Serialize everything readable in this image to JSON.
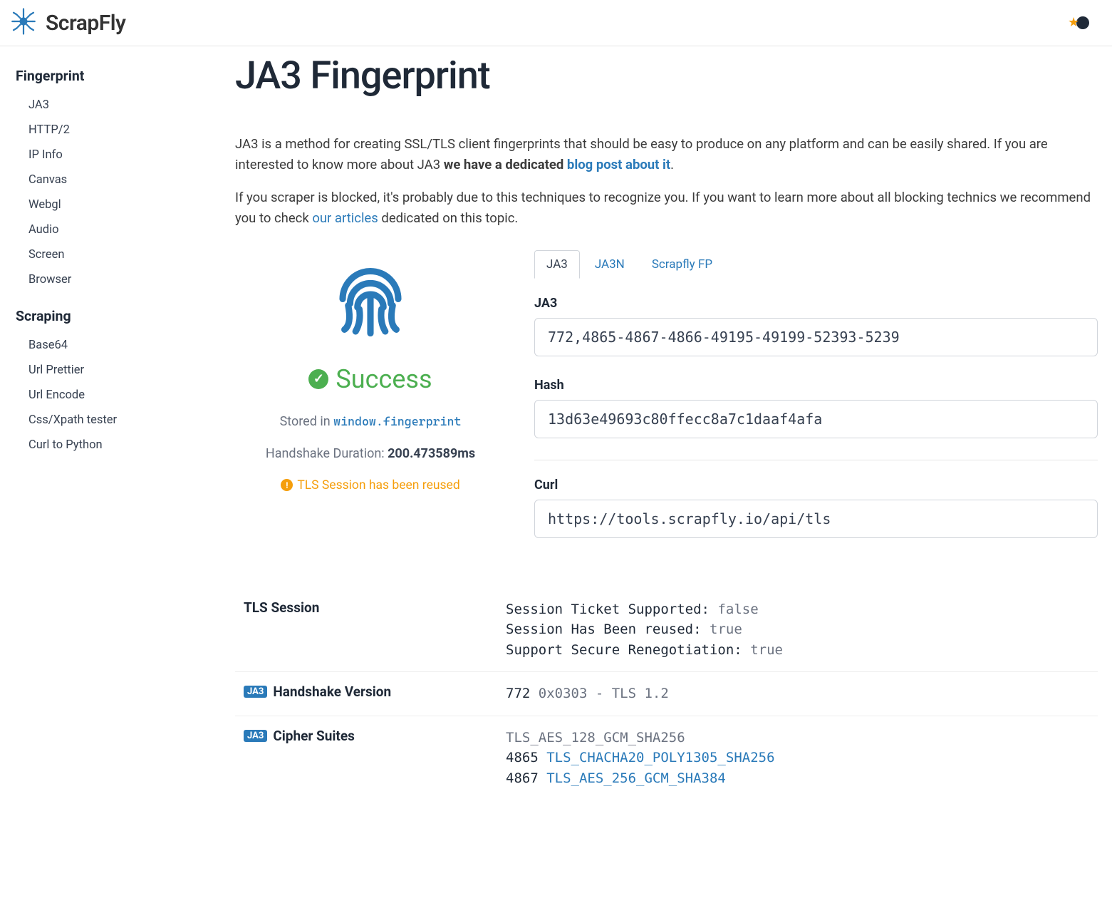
{
  "brand": "ScrapFly",
  "sidebar": {
    "fingerprint": {
      "heading": "Fingerprint",
      "items": [
        "JA3",
        "HTTP/2",
        "IP Info",
        "Canvas",
        "Webgl",
        "Audio",
        "Screen",
        "Browser"
      ]
    },
    "scraping": {
      "heading": "Scraping",
      "items": [
        "Base64",
        "Url Prettier",
        "Url Encode",
        "Css/Xpath tester",
        "Curl to Python"
      ]
    }
  },
  "page": {
    "title": "JA3 Fingerprint",
    "intro1a": "JA3 is a method for creating SSL/TLS client fingerprints that should be easy to produce on any platform and can be easily shared. If you are interested to know more about JA3 ",
    "intro1b": "we have a dedicated ",
    "intro1link": "blog post about it",
    "intro1c": ".",
    "intro2a": "If you scraper is blocked, it's probably due to this techniques to recognize you. If you want to learn more about all blocking technics we recommend you to check ",
    "intro2link": "our articles",
    "intro2b": " dedicated on this topic."
  },
  "status": {
    "success": "Success",
    "stored_prefix": "Stored in ",
    "stored_code": "window.fingerprint",
    "handshake_label": "Handshake Duration: ",
    "handshake_value": "200.473589ms",
    "tls_warning": "TLS Session has been reused"
  },
  "tabs": [
    "JA3",
    "JA3N",
    "Scrapfly FP"
  ],
  "fields": {
    "ja3": {
      "label": "JA3",
      "value": "772,4865-4867-4866-49195-49199-52393-5239"
    },
    "hash": {
      "label": "Hash",
      "value": "13d63e49693c80ffecc8a7c1daaf4afa"
    },
    "curl": {
      "label": "Curl",
      "value": "https://tools.scrapfly.io/api/tls"
    }
  },
  "tls_session": {
    "heading": "TLS Session",
    "rows": [
      {
        "k": "Session Ticket Supported:",
        "v": "false"
      },
      {
        "k": "Session Has Been reused:",
        "v": "true"
      },
      {
        "k": "Support Secure Renegotiation:",
        "v": "true"
      }
    ]
  },
  "handshake_version": {
    "heading": "Handshake Version",
    "tag": "JA3",
    "num": "772",
    "rest": " 0x0303 - TLS 1.2"
  },
  "cipher_suites": {
    "heading": "Cipher Suites",
    "tag": "JA3",
    "lines": [
      {
        "plain": "TLS_AES_128_GCM_SHA256"
      },
      {
        "num": "4865",
        "link": "TLS_CHACHA20_POLY1305_SHA256"
      },
      {
        "num": "4867",
        "link": "TLS_AES_256_GCM_SHA384"
      }
    ]
  }
}
